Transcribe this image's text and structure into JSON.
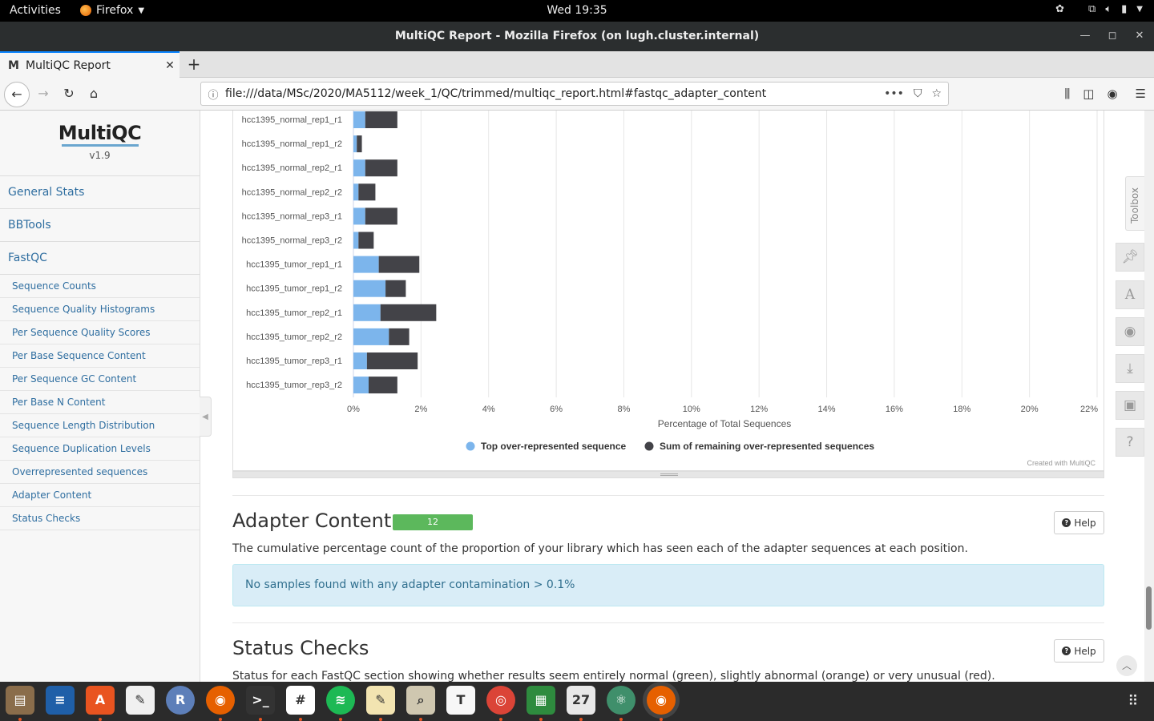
{
  "topbar": {
    "activities": "Activities",
    "app_name": "Firefox",
    "clock": "Wed 19:35"
  },
  "window": {
    "title": "MultiQC Report - Mozilla Firefox (on lugh.cluster.internal)"
  },
  "tab": {
    "favicon": "M",
    "title": "MultiQC Report"
  },
  "navbar": {
    "url": "file:///data/MSc/2020/MA5112/week_1/QC/trimmed/multiqc_report.html#fastqc_adapter_content"
  },
  "sidebar": {
    "logo": "MultiQC",
    "version": "v1.9",
    "main_items": [
      "General Stats",
      "BBTools",
      "FastQC"
    ],
    "sub_items": [
      "Sequence Counts",
      "Sequence Quality Histograms",
      "Per Sequence Quality Scores",
      "Per Base Sequence Content",
      "Per Sequence GC Content",
      "Per Base N Content",
      "Sequence Length Distribution",
      "Sequence Duplication Levels",
      "Overrepresented sequences",
      "Adapter Content",
      "Status Checks"
    ]
  },
  "chart_data": {
    "type": "bar",
    "orientation": "horizontal",
    "stacked": true,
    "categories": [
      "hcc1395_normal_rep1_r1",
      "hcc1395_normal_rep1_r2",
      "hcc1395_normal_rep2_r1",
      "hcc1395_normal_rep2_r2",
      "hcc1395_normal_rep3_r1",
      "hcc1395_normal_rep3_r2",
      "hcc1395_tumor_rep1_r1",
      "hcc1395_tumor_rep1_r2",
      "hcc1395_tumor_rep2_r1",
      "hcc1395_tumor_rep2_r2",
      "hcc1395_tumor_rep3_r1",
      "hcc1395_tumor_rep3_r2"
    ],
    "series": [
      {
        "name": "Top over-represented sequence",
        "color": "#7cb5ec",
        "values": [
          0.35,
          0.1,
          0.35,
          0.15,
          0.35,
          0.15,
          0.75,
          0.95,
          0.8,
          1.05,
          0.4,
          0.45
        ]
      },
      {
        "name": "Sum of remaining over-represented sequences",
        "color": "#434348",
        "values": [
          0.95,
          0.15,
          0.95,
          0.5,
          0.95,
          0.45,
          1.2,
          0.6,
          1.65,
          0.6,
          1.5,
          0.85
        ]
      }
    ],
    "xlabel": "Percentage of Total Sequences",
    "xlim": [
      0,
      22
    ],
    "xticks": [
      "0%",
      "2%",
      "4%",
      "6%",
      "8%",
      "10%",
      "12%",
      "14%",
      "16%",
      "18%",
      "20%",
      "22%"
    ],
    "grid": true,
    "legend_position": "bottom",
    "credit": "Created with MultiQC"
  },
  "adapter": {
    "title": "Adapter Content",
    "badge": "12",
    "help": "Help",
    "description": "The cumulative percentage count of the proportion of your library which has seen each of the adapter sequences at each position.",
    "alert": "No samples found with any adapter contamination > 0.1%"
  },
  "status": {
    "title": "Status Checks",
    "help": "Help",
    "description": "Status for each FastQC section showing whether results seem entirely normal (green), slightly abnormal (orange) or very unusual (red)."
  },
  "toolbox": {
    "label": "Toolbox",
    "buttons": [
      "pin-icon",
      "font-icon",
      "eye-slash-icon",
      "download-icon",
      "save-icon",
      "question-icon"
    ]
  },
  "dock": {
    "apps": [
      "files",
      "writer",
      "software",
      "text-editor",
      "r",
      "firefox",
      "terminal",
      "slack",
      "spotify",
      "notes",
      "image-viewer",
      "typora",
      "chrome",
      "calc",
      "calendar",
      "atom",
      "firefox-active"
    ]
  }
}
